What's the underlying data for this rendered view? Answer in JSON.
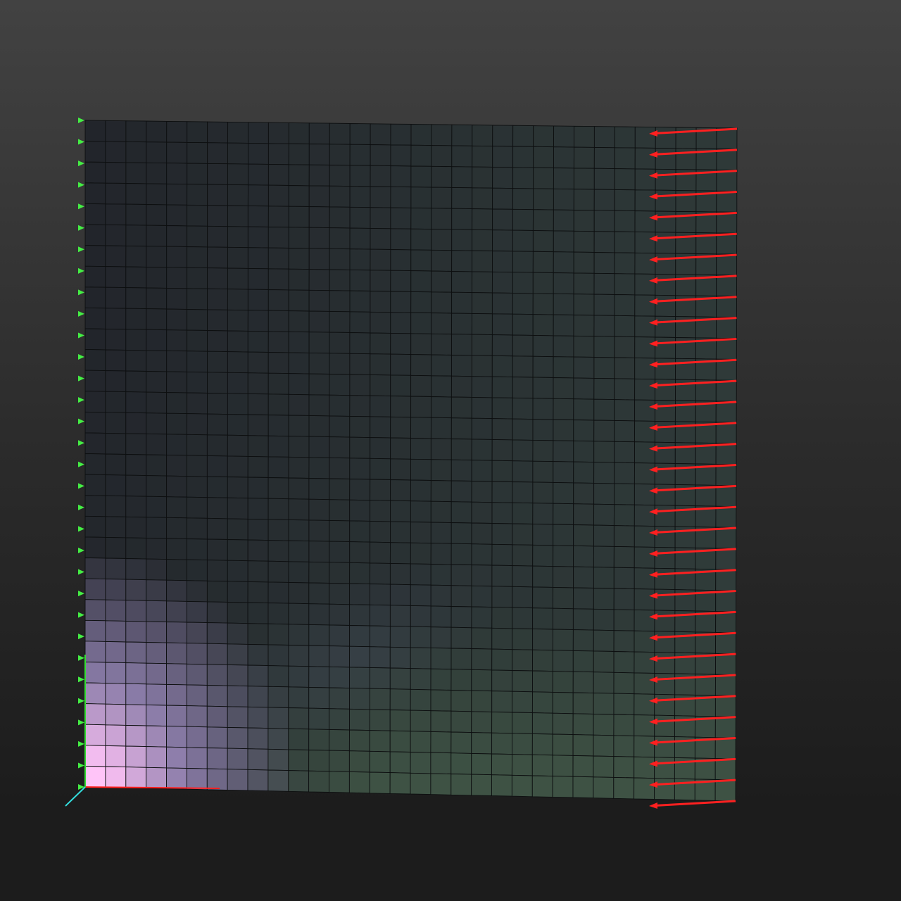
{
  "scene": {
    "background_colors": [
      "#424242",
      "#1c1c1c"
    ],
    "mesh": {
      "columns": 32,
      "rows": 32,
      "edge_color": "#0d0f10",
      "color_scale": {
        "low": "#22252b",
        "mid_purple": "#8a7ca8",
        "high": "#ffc4f8",
        "green_tint": "#3e5244"
      }
    },
    "boundary_conditions": {
      "fixed_edge": "left",
      "fixed_marker_count": 32,
      "fixed_marker_color": "#44ee44",
      "load_edge": "right",
      "load_arrow_count": 33,
      "load_arrow_direction": "-x",
      "load_arrow_color": "#ff2020"
    },
    "axes_triad": {
      "x_color": "#ff2020",
      "y_color": "#33dd33",
      "z_color": "#33dddd"
    }
  }
}
